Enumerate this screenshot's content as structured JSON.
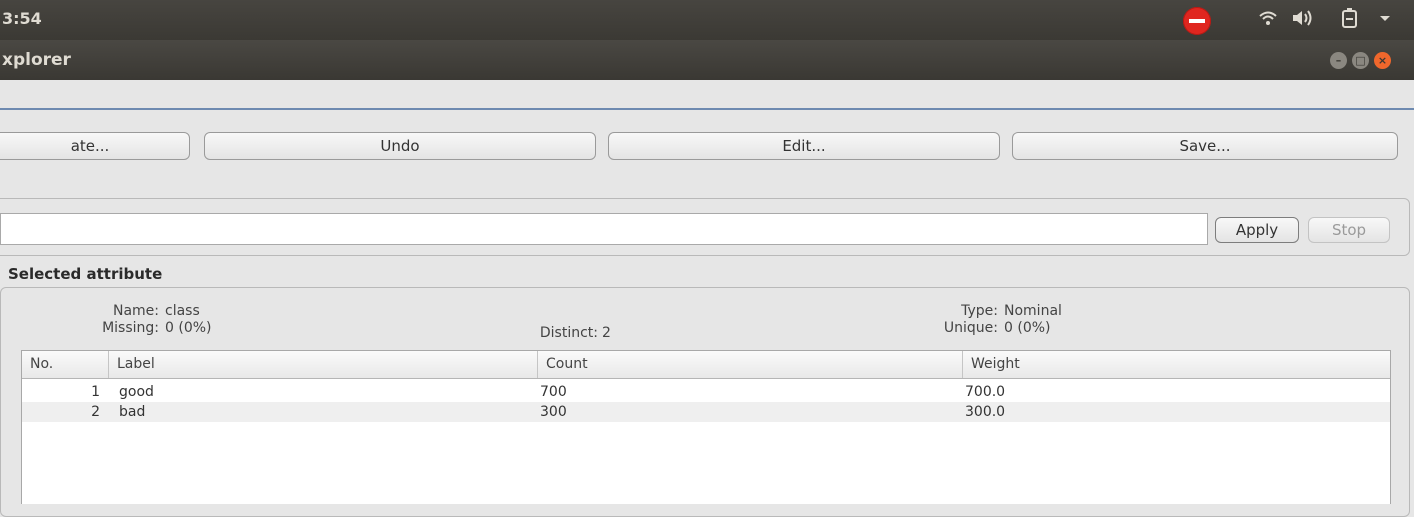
{
  "system": {
    "clock": "3:54",
    "tray_icons": [
      "no-entry-icon",
      "wifi-icon",
      "volume-icon",
      "battery-icon",
      "dropdown-arrow-icon"
    ]
  },
  "window": {
    "title": "xplorer"
  },
  "toolbar": {
    "generate_label": "ate...",
    "undo_label": "Undo",
    "edit_label": "Edit...",
    "save_label": "Save..."
  },
  "filter": {
    "value": "",
    "apply_label": "Apply",
    "stop_label": "Stop"
  },
  "selected_attribute": {
    "heading": "Selected attribute",
    "name_label": "Name:",
    "name_value": "class",
    "missing_label": "Missing:",
    "missing_value": "0 (0%)",
    "distinct_label": "Distinct:",
    "distinct_value": "2",
    "type_label": "Type:",
    "type_value": "Nominal",
    "unique_label": "Unique:",
    "unique_value": "0 (0%)"
  },
  "table": {
    "headers": [
      "No.",
      "Label",
      "Count",
      "Weight"
    ],
    "rows": [
      {
        "no": "1",
        "label": "good",
        "count": "700",
        "weight": "700.0"
      },
      {
        "no": "2",
        "label": "bad",
        "count": "300",
        "weight": "300.0"
      }
    ]
  }
}
